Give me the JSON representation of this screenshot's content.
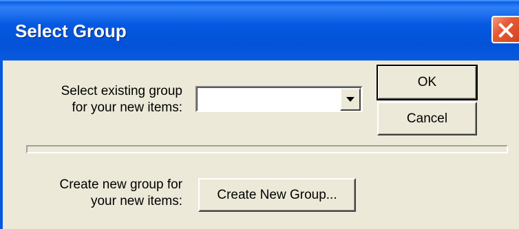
{
  "window": {
    "title": "Select Group",
    "close_icon": "close-icon",
    "titlebar_color": "#0558e0",
    "close_color": "#e65a34"
  },
  "existing": {
    "label_line1": "Select existing group",
    "label_line2": "for your new items:",
    "combo_value": "",
    "dropdown_icon": "dropdown-arrow-icon"
  },
  "buttons": {
    "ok": "OK",
    "cancel": "Cancel",
    "create_new": "Create New Group..."
  },
  "create": {
    "label_line1": "Create new group for",
    "label_line2": "your new items:"
  }
}
